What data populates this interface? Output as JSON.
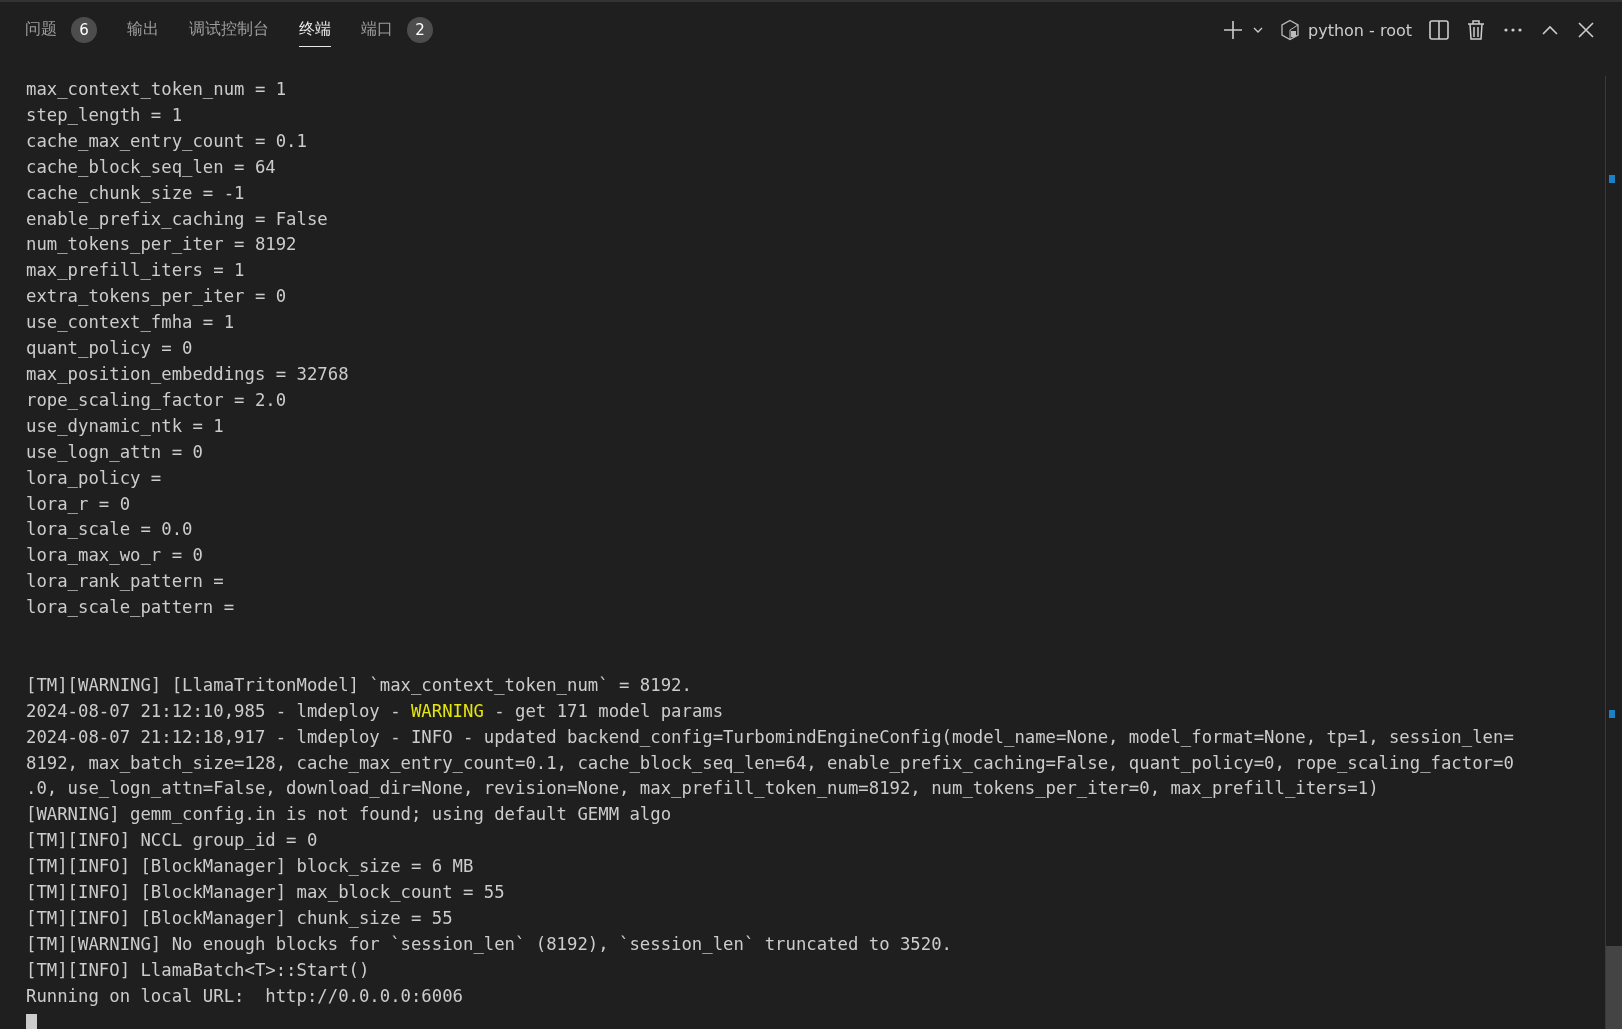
{
  "tabs": [
    {
      "label": "问题",
      "badge": "6",
      "selected": false
    },
    {
      "label": "输出",
      "selected": false
    },
    {
      "label": "调试控制台",
      "selected": false
    },
    {
      "label": "终端",
      "selected": true
    },
    {
      "label": "端口",
      "badge": "2",
      "selected": false
    }
  ],
  "toolbar": {
    "terminal_name": "python - root"
  },
  "config_lines": [
    "max_context_token_num = 1",
    "step_length = 1",
    "cache_max_entry_count = 0.1",
    "cache_block_seq_len = 64",
    "cache_chunk_size = -1",
    "enable_prefix_caching = False",
    "num_tokens_per_iter = 8192",
    "max_prefill_iters = 1",
    "extra_tokens_per_iter = 0",
    "use_context_fmha = 1",
    "quant_policy = 0",
    "max_position_embeddings = 32768",
    "rope_scaling_factor = 2.0",
    "use_dynamic_ntk = 1",
    "use_logn_attn = 0",
    "lora_policy =",
    "lora_r = 0",
    "lora_scale = 0.0",
    "lora_max_wo_r = 0",
    "lora_rank_pattern =",
    "lora_scale_pattern ="
  ],
  "log_lines": [
    [
      {
        "text": "[TM][WARNING] [LlamaTritonModel] `max_context_token_num` = 8192.",
        "kind": "plain"
      }
    ],
    [
      {
        "text": "2024-08-07 21:12:10,985 - lmdeploy - ",
        "kind": "plain"
      },
      {
        "text": "WARNING",
        "kind": "warning"
      },
      {
        "text": " - get 171 model params",
        "kind": "plain"
      }
    ],
    [
      {
        "text": "2024-08-07 21:12:18,917 - lmdeploy - INFO - updated backend_config=TurbomindEngineConfig(model_name=None, model_format=None, tp=1, session_len=",
        "kind": "plain"
      }
    ],
    [
      {
        "text": "8192, max_batch_size=128, cache_max_entry_count=0.1, cache_block_seq_len=64, enable_prefix_caching=False, quant_policy=0, rope_scaling_factor=0",
        "kind": "plain"
      }
    ],
    [
      {
        "text": ".0, use_logn_attn=False, download_dir=None, revision=None, max_prefill_token_num=8192, num_tokens_per_iter=0, max_prefill_iters=1)",
        "kind": "plain"
      }
    ],
    [
      {
        "text": "[WARNING] gemm_config.in is not found; using default GEMM algo",
        "kind": "plain"
      }
    ],
    [
      {
        "text": "[TM][INFO] NCCL group_id = 0",
        "kind": "plain"
      }
    ],
    [
      {
        "text": "[TM][INFO] [BlockManager] block_size = 6 MB",
        "kind": "plain"
      }
    ],
    [
      {
        "text": "[TM][INFO] [BlockManager] max_block_count = 55",
        "kind": "plain"
      }
    ],
    [
      {
        "text": "[TM][INFO] [BlockManager] chunk_size = 55",
        "kind": "plain"
      }
    ],
    [
      {
        "text": "[TM][WARNING] No enough blocks for `session_len` (8192), `session_len` truncated to 3520.",
        "kind": "plain"
      }
    ],
    [
      {
        "text": "[TM][INFO] LlamaBatch<T>::Start()",
        "kind": "plain"
      }
    ],
    [
      {
        "text": "Running on local URL:  http://0.0.0.0:6006",
        "kind": "plain"
      }
    ]
  ]
}
